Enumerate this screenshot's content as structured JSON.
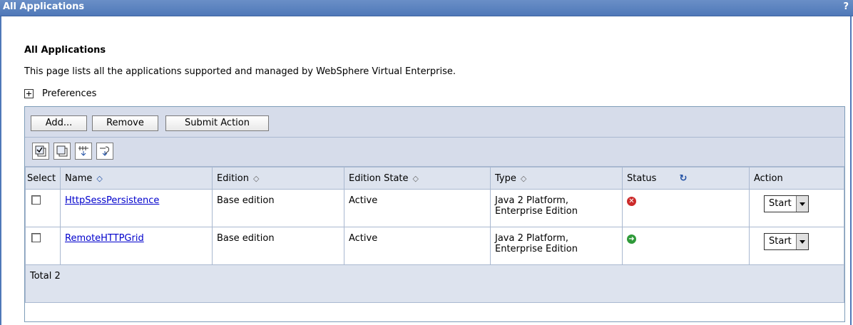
{
  "window": {
    "title": "All Applications",
    "help": "?"
  },
  "page": {
    "heading": "All Applications",
    "description": "This page lists all the applications supported and managed by WebSphere Virtual Enterprise.",
    "preferences_label": "Preferences"
  },
  "toolbar": {
    "add_label": "Add...",
    "remove_label": "Remove",
    "submit_label": "Submit Action"
  },
  "icons": [
    "select-all-icon",
    "deselect-all-icon",
    "show-filter-icon",
    "clear-filter-icon"
  ],
  "table": {
    "headers": {
      "select": "Select",
      "name": "Name",
      "edition": "Edition",
      "edition_state": "Edition State",
      "type": "Type",
      "status": "Status",
      "action": "Action"
    },
    "rows": [
      {
        "name": "HttpSessPersistence",
        "edition": "Base edition",
        "edition_state": "Active",
        "type_line1": "Java 2 Platform,",
        "type_line2": "Enterprise Edition",
        "status": "stopped",
        "status_color": "#cc2a2a",
        "action": "Start"
      },
      {
        "name": "RemoteHTTPGrid",
        "edition": "Base edition",
        "edition_state": "Active",
        "type_line1": "Java 2 Platform,",
        "type_line2": "Enterprise Edition",
        "status": "started",
        "status_color": "#2f9a3a",
        "action": "Start"
      }
    ],
    "total": "Total 2"
  }
}
